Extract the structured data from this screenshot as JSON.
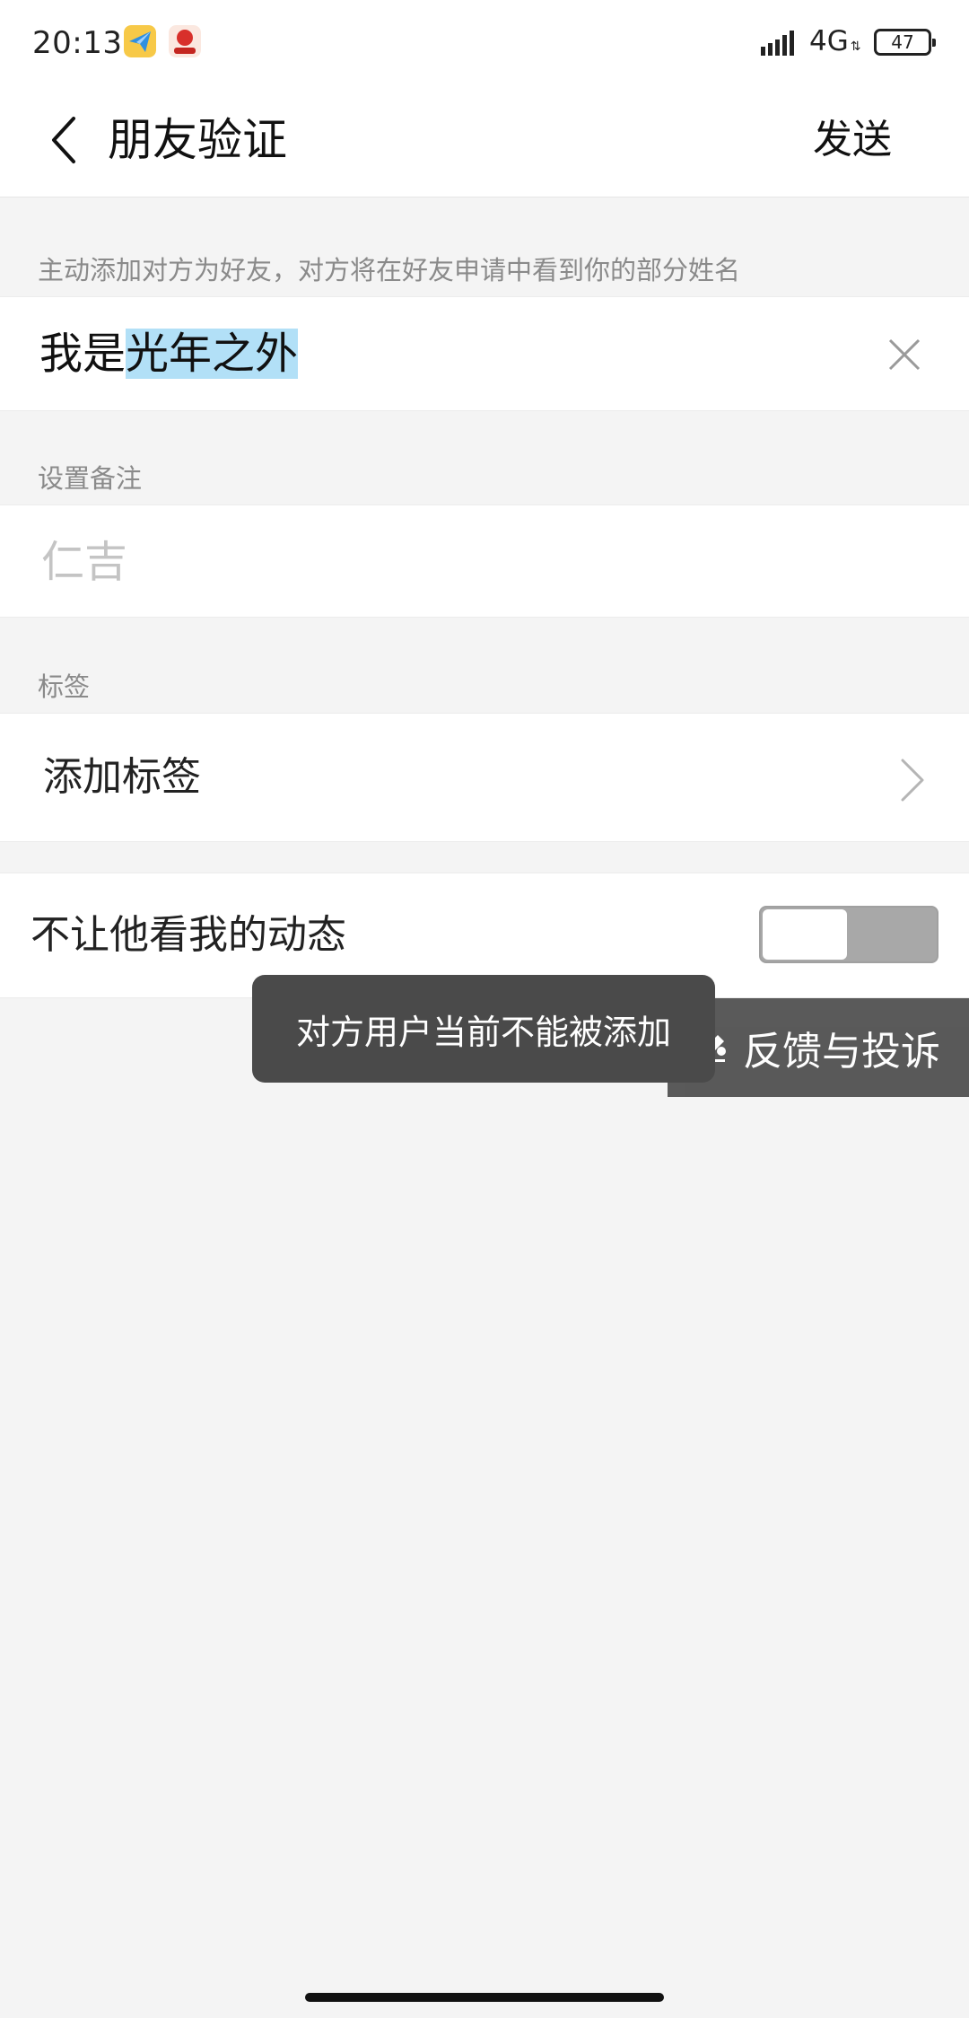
{
  "status_bar": {
    "time": "20:13",
    "network": "4G",
    "battery": "47"
  },
  "header": {
    "title": "朋友验证",
    "send_label": "发送"
  },
  "greeting_section": {
    "hint": "主动添加对方为好友，对方将在好友申请中看到你的部分姓名",
    "prefix": "我是",
    "selected_text": "光年之外"
  },
  "remark_section": {
    "label": "设置备注",
    "placeholder": "仁吉"
  },
  "tags_section": {
    "label": "标签",
    "add_label": "添加标签"
  },
  "moments": {
    "label": "不让他看我的动态",
    "enabled": false
  },
  "toast": {
    "message": "对方用户当前不能被添加"
  },
  "feedback": {
    "label": "反馈与投诉"
  },
  "colors": {
    "selection": "#b2e0f7",
    "background": "#f4f4f4",
    "toast": "#4a4a4a",
    "toggle_track": "#a8a8a8"
  }
}
